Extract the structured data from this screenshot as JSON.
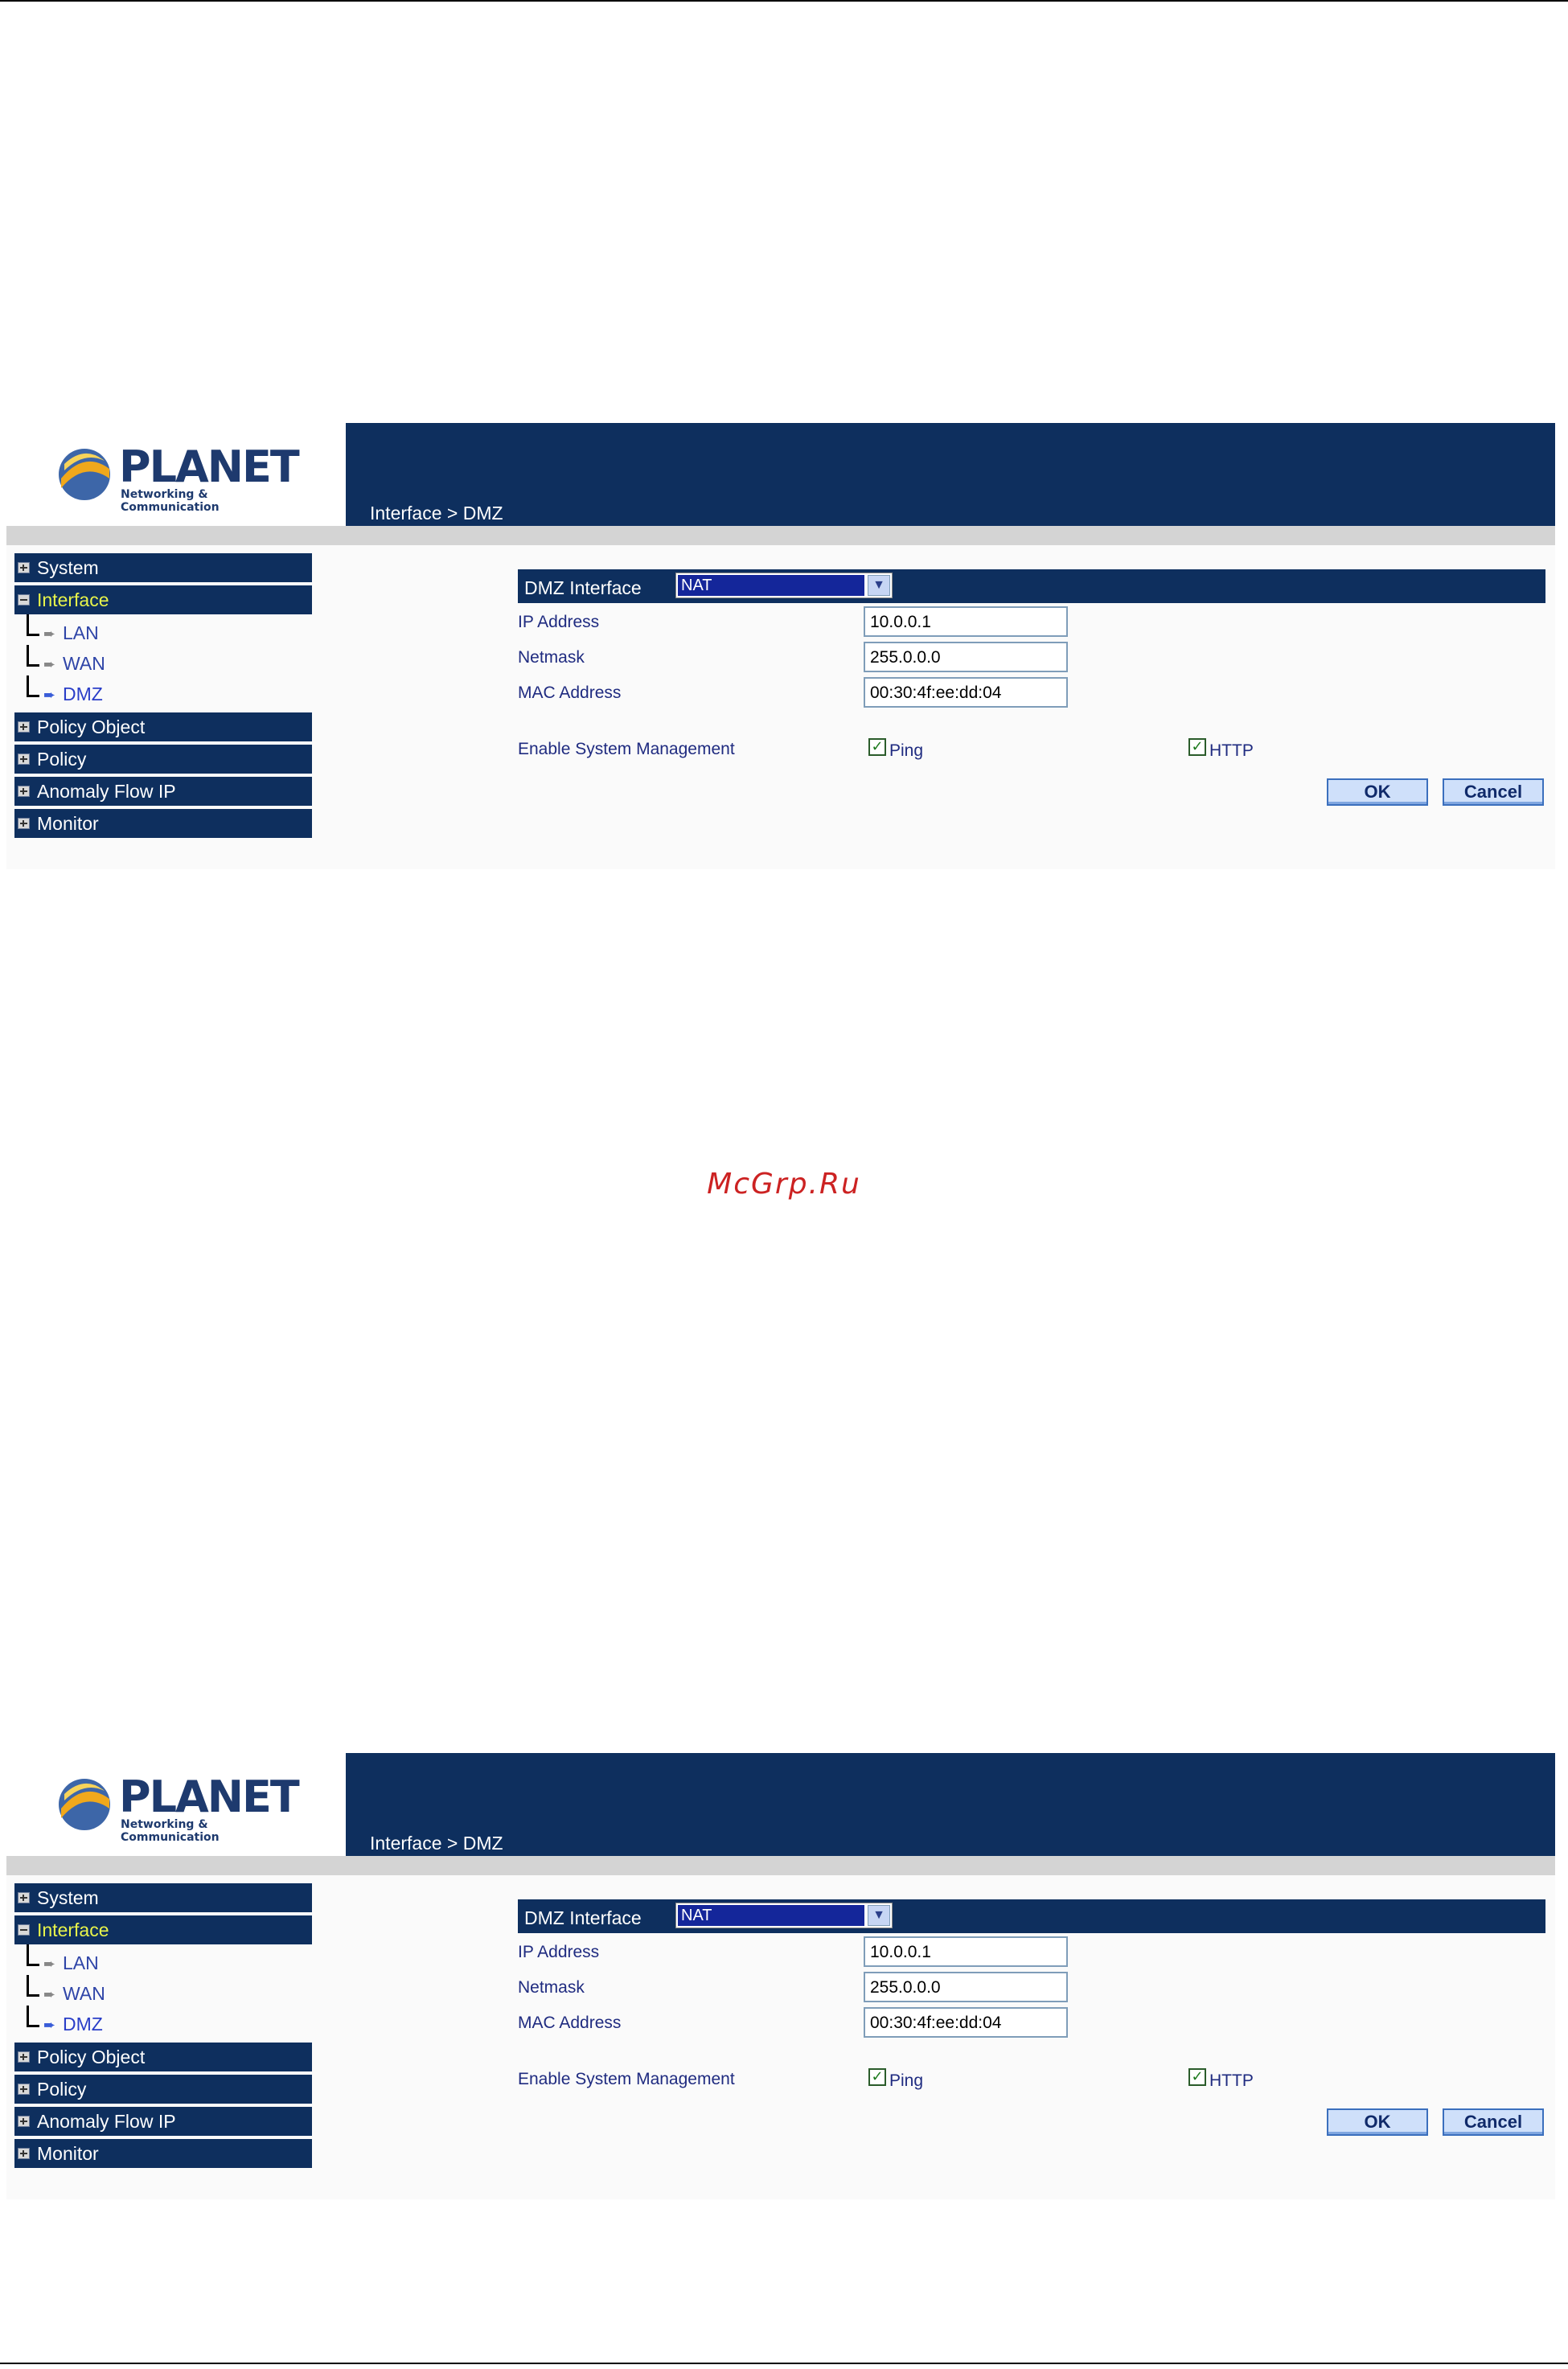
{
  "screens": [
    {
      "logo": {
        "word": "PLANET",
        "tagline": "Networking & Communication"
      },
      "breadcrumb": "Interface > DMZ",
      "menu": [
        {
          "label": "System",
          "expanded": false
        },
        {
          "label": "Interface",
          "expanded": true,
          "active": true,
          "children": [
            "LAN",
            "WAN",
            "DMZ"
          ],
          "selected_child": "DMZ"
        },
        {
          "label": "Policy Object",
          "expanded": false
        },
        {
          "label": "Policy",
          "expanded": false
        },
        {
          "label": "Anomaly Flow IP",
          "expanded": false
        },
        {
          "label": "Monitor",
          "expanded": false
        }
      ],
      "form": {
        "header_label": "DMZ Interface",
        "mode_value": "NAT",
        "ip_label": "IP Address",
        "ip_value": "10.0.0.1",
        "netmask_label": "Netmask",
        "netmask_value": "255.0.0.0",
        "mac_label": "MAC Address",
        "mac_value": "00:30:4f:ee:dd:04",
        "mgmt_label": "Enable System Management",
        "ping_label": "Ping",
        "ping_checked": true,
        "http_label": "HTTP",
        "http_checked": true,
        "ok_label": "OK",
        "cancel_label": "Cancel"
      }
    },
    {
      "logo": {
        "word": "PLANET",
        "tagline": "Networking & Communication"
      },
      "breadcrumb": "Interface > DMZ",
      "menu": [
        {
          "label": "System",
          "expanded": false
        },
        {
          "label": "Interface",
          "expanded": true,
          "active": true,
          "children": [
            "LAN",
            "WAN",
            "DMZ"
          ],
          "selected_child": "DMZ"
        },
        {
          "label": "Policy Object",
          "expanded": false
        },
        {
          "label": "Policy",
          "expanded": false
        },
        {
          "label": "Anomaly Flow IP",
          "expanded": false
        },
        {
          "label": "Monitor",
          "expanded": false
        }
      ],
      "form": {
        "header_label": "DMZ Interface",
        "mode_value": "NAT",
        "ip_label": "IP Address",
        "ip_value": "10.0.0.1",
        "netmask_label": "Netmask",
        "netmask_value": "255.0.0.0",
        "mac_label": "MAC Address",
        "mac_value": "00:30:4f:ee:dd:04",
        "mgmt_label": "Enable System Management",
        "ping_label": "Ping",
        "ping_checked": true,
        "http_label": "HTTP",
        "http_checked": true,
        "ok_label": "OK",
        "cancel_label": "Cancel"
      }
    }
  ],
  "watermark": "McGrp.Ru",
  "colors": {
    "header_navy": "#0e2f5e",
    "active_menu_text": "#e8f44a",
    "label_blue": "#1f2b80",
    "watermark_red": "#cc2222"
  }
}
